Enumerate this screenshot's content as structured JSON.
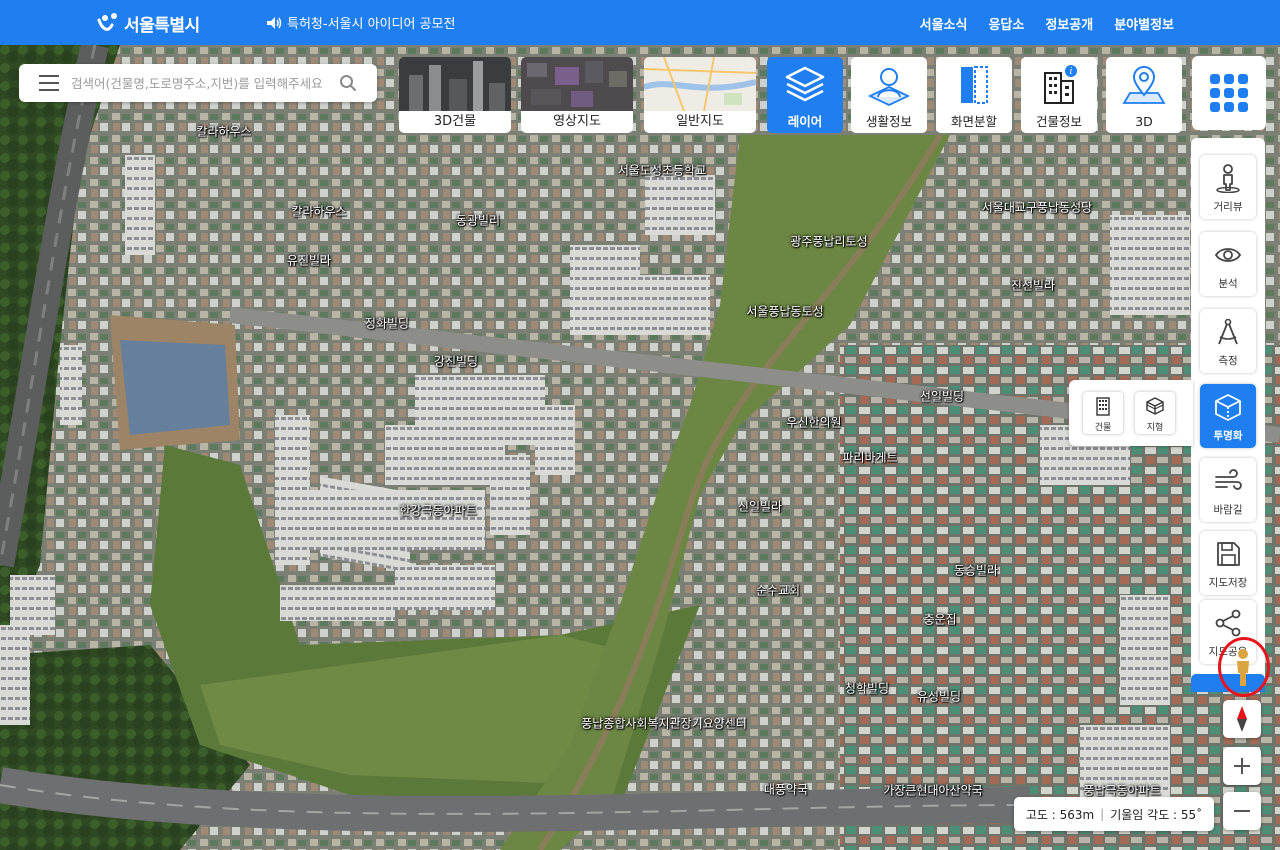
{
  "header": {
    "logo_text": "서울특별시",
    "notice": "특허청-서울시 아이디어 공모전",
    "nav": [
      "서울소식",
      "응답소",
      "정보공개",
      "분야별정보"
    ]
  },
  "search": {
    "placeholder": "검색어(건물명,도로명주소,지번)를 입력해주세요"
  },
  "toolbar": {
    "building_3d": "3D건물",
    "satellite": "영상지도",
    "general_map": "일반지도",
    "layer": "레이어",
    "life_info": "생활정보",
    "split_screen": "화면분할",
    "building_info": "건물정보",
    "view_3d": "3D"
  },
  "tools": {
    "street_view": "거리뷰",
    "analysis": "분석",
    "measure": "측정",
    "transparency": "투명화",
    "wind_path": "바람길",
    "save_map": "지도저장",
    "share_map": "지도공유"
  },
  "transparency_popup": {
    "building": "건물",
    "terrain": "지형"
  },
  "status": {
    "altitude": "고도 : 563m",
    "tilt": "기울임 각도 : 55˚"
  },
  "map_labels": [
    "칼라하우스",
    "칼라하우스",
    "유진빌라",
    "정화빌딩",
    "동광빌리",
    "서울도성초등학교",
    "광주풍납리토성",
    "서울풍납동토성",
    "서울대교구풍납동성당",
    "진선빌라",
    "강진빌딩",
    "선일빌딩",
    "우신한의원",
    "파리바게트",
    "한강극동아파트",
    "신일빌라",
    "동승빌라",
    "순수교회",
    "충운집",
    "청학빌딩",
    "유성빌딩",
    "풍납종합사회복지관장기요양센터",
    "대풍약국",
    "가장큰현대아산약국",
    "풍납극동아파트"
  ],
  "colors": {
    "brand_blue": "#1f7ff0",
    "highlight_red": "#e8141c"
  },
  "icons": {
    "menu": "hamburger-icon",
    "search": "search-icon",
    "apps": "grid-icon",
    "street_view": "pedestrian-icon"
  }
}
